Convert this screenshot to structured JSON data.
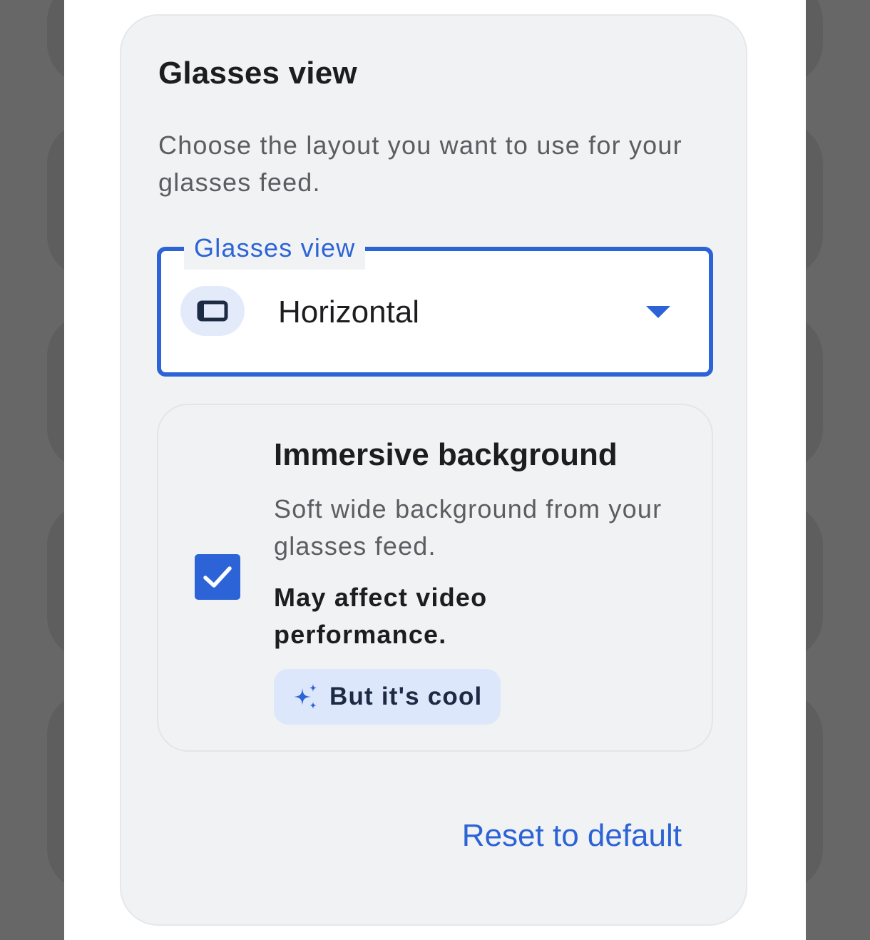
{
  "panel": {
    "title": "Glasses view",
    "description": "Choose the layout you want to use for your glasses feed."
  },
  "layout_select": {
    "label": "Glasses view",
    "value": "Horizontal",
    "icon": "landscape-glasses-icon",
    "dropdown_icon": "dropdown-arrow-icon"
  },
  "immersive_option": {
    "checked": true,
    "title": "Immersive background",
    "description": "Soft wide background from your glasses feed.",
    "warning": "May affect video performance.",
    "chip_label": "But it's cool",
    "chip_icon": "sparkle-icon"
  },
  "footer": {
    "reset_label": "Reset to default"
  },
  "colors": {
    "accent": "#2c63d6",
    "panel_background": "#f1f2f4",
    "chip_background": "#dde7fb",
    "scrim": "#676767"
  }
}
